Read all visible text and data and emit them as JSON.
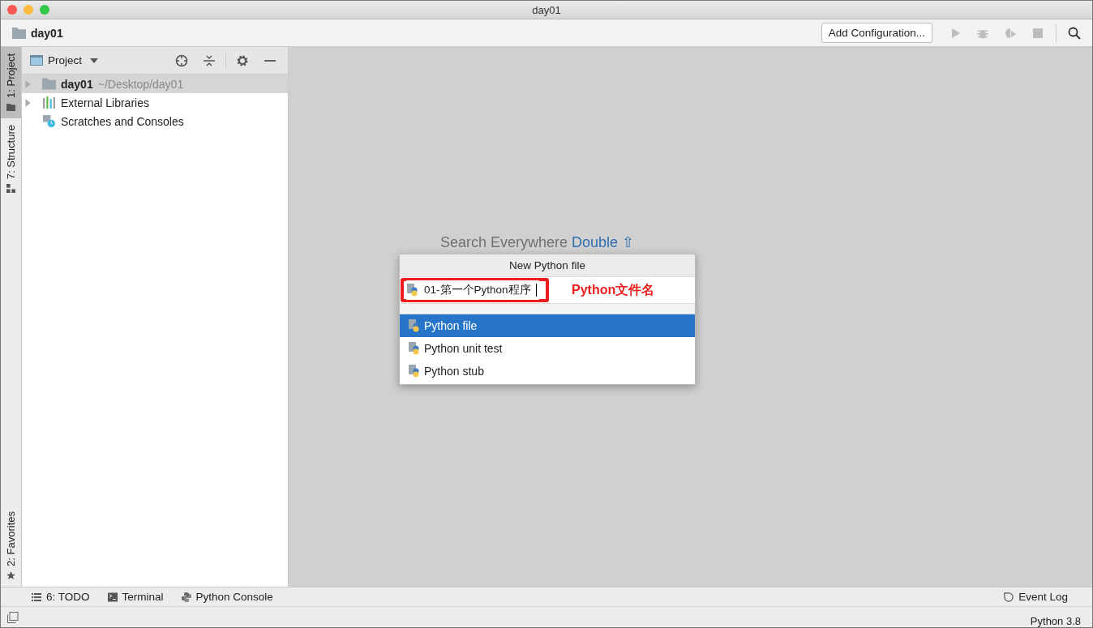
{
  "window": {
    "title": "day01"
  },
  "nav_bar": {
    "project": "day01",
    "config_button": "Add Configuration..."
  },
  "side_tabs_top": [
    {
      "label": "1: Project",
      "selected": true
    },
    {
      "label": "7: Structure",
      "selected": false
    }
  ],
  "side_tabs_bottom": [
    {
      "label": "2: Favorites",
      "selected": false
    }
  ],
  "project_panel": {
    "title": "Project",
    "tree": [
      {
        "label": "day01",
        "path": "~/Desktop/day01",
        "expandable": true,
        "selected": true
      },
      {
        "label": "External Libraries",
        "expandable": true,
        "selected": false
      },
      {
        "label": "Scratches and Consoles",
        "expandable": false,
        "selected": false
      }
    ]
  },
  "editor": {
    "hint_text": "Search Everywhere",
    "hint_shortcut": "Double ⇧"
  },
  "new_file_popup": {
    "title": "New Python file",
    "value": "01-第一个Python程序",
    "annotation": "Python文件名",
    "options": [
      {
        "label": "Python file",
        "selected": true
      },
      {
        "label": "Python unit test",
        "selected": false
      },
      {
        "label": "Python stub",
        "selected": false
      }
    ]
  },
  "bottom_tabs": [
    {
      "label": "6: TODO"
    },
    {
      "label": "Terminal"
    },
    {
      "label": "Python Console"
    }
  ],
  "event_log": "Event Log",
  "status_bar": {
    "interpreter": "Python 3.8"
  }
}
